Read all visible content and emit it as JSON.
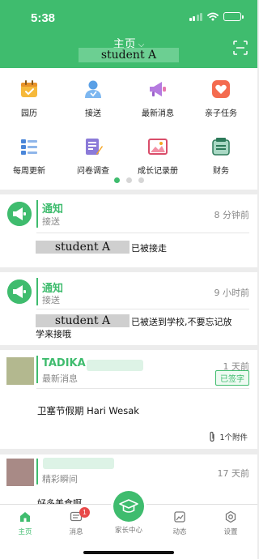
{
  "status": {
    "time": "5:38"
  },
  "header": {
    "title": "主页",
    "student": "student A"
  },
  "grid": {
    "row1": [
      {
        "label": "园历",
        "icon": "calendar-icon"
      },
      {
        "label": "接送",
        "icon": "person-icon"
      },
      {
        "label": "最新消息",
        "icon": "megaphone-icon"
      },
      {
        "label": "亲子任务",
        "icon": "heart-task-icon"
      }
    ],
    "row2": [
      {
        "label": "每周更新",
        "icon": "weekly-list-icon"
      },
      {
        "label": "问卷调查",
        "icon": "survey-icon"
      },
      {
        "label": "成长记录册",
        "icon": "photo-album-icon"
      },
      {
        "label": "财务",
        "icon": "finance-icon"
      }
    ]
  },
  "feed": [
    {
      "title": "通知",
      "subtitle": "接送",
      "time": "8 分钟前",
      "student": "student A",
      "message": "已被接走"
    },
    {
      "title": "通知",
      "subtitle": "接送",
      "time": "9 小时前",
      "student": "student A",
      "message_line1": "已被送到学校,不要忘记放",
      "message_line2": "学来接哦"
    },
    {
      "title": "TADIKA",
      "subtitle": "最新消息",
      "time": "1 天前",
      "badge": "已签字",
      "message": "卫塞节假期  Hari Wesak",
      "attachment": "1个附件"
    },
    {
      "subtitle": "精彩瞬间",
      "time": "17 天前",
      "preview": "好多美食啊"
    }
  ],
  "tabs": [
    {
      "label": "主页",
      "icon": "home-icon"
    },
    {
      "label": "消息",
      "icon": "message-icon",
      "badge": "1"
    },
    {
      "label": "家长中心",
      "icon": "graduation-cap-icon"
    },
    {
      "label": "动态",
      "icon": "moments-icon"
    },
    {
      "label": "设置",
      "icon": "settings-icon"
    }
  ],
  "colors": {
    "accent": "#3fbc6e",
    "badge": "#e84a4a"
  }
}
